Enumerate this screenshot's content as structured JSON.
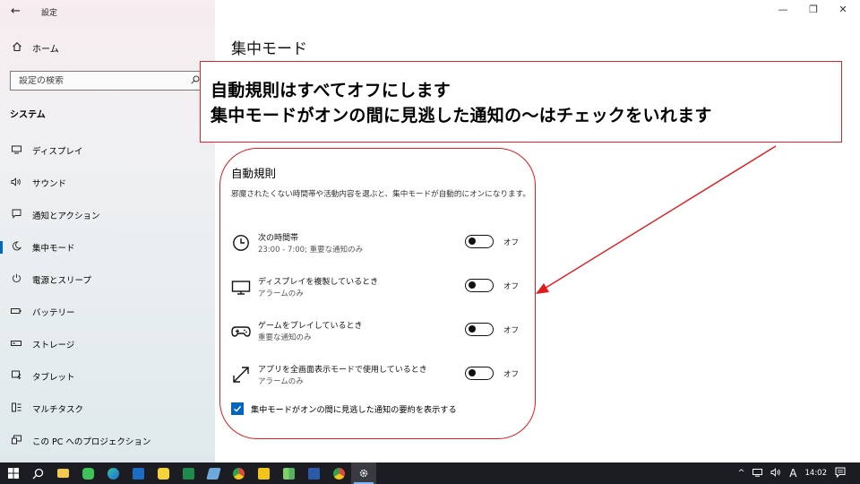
{
  "window": {
    "app_title": "設定",
    "back_glyph": "←",
    "minimize_glyph": "—",
    "restore_glyph": "❐",
    "close_glyph": "✕"
  },
  "sidebar": {
    "home_label": "ホーム",
    "search_placeholder": "設定の検索",
    "section_title": "システム",
    "items": [
      {
        "label": "ディスプレイ",
        "icon": "monitor-icon"
      },
      {
        "label": "サウンド",
        "icon": "speaker-icon"
      },
      {
        "label": "通知とアクション",
        "icon": "notification-icon"
      },
      {
        "label": "集中モード",
        "icon": "moon-icon",
        "active": true
      },
      {
        "label": "電源とスリープ",
        "icon": "power-icon"
      },
      {
        "label": "バッテリー",
        "icon": "battery-icon"
      },
      {
        "label": "ストレージ",
        "icon": "storage-icon"
      },
      {
        "label": "タブレット",
        "icon": "tablet-icon"
      },
      {
        "label": "マルチタスク",
        "icon": "multitask-icon"
      },
      {
        "label": "この PC へのプロジェクション",
        "icon": "projection-icon"
      }
    ]
  },
  "main": {
    "page_title": "集中モード",
    "callout_line1": "自動規則はすべてオフにします",
    "callout_line2": "集中モードがオンの間に見逃した通知の～はチェックをいれます",
    "auto_heading": "自動規則",
    "auto_desc": "邪魔されたくない時間帯や活動内容を選ぶと、集中モードが自動的にオンになります。",
    "rules": [
      {
        "title": "次の時間帯",
        "subtitle": "23:00 - 7:00; 重要な通知のみ",
        "toggle_label": "オフ",
        "on": false,
        "icon": "clock-icon"
      },
      {
        "title": "ディスプレイを複製しているとき",
        "subtitle": "アラームのみ",
        "toggle_label": "オフ",
        "on": false,
        "icon": "display-icon"
      },
      {
        "title": "ゲームをプレイしているとき",
        "subtitle": "重要な通知のみ",
        "toggle_label": "オフ",
        "on": false,
        "icon": "gamepad-icon"
      },
      {
        "title": "アプリを全画面表示モードで使用しているとき",
        "subtitle": "アラームのみ",
        "toggle_label": "オフ",
        "on": false,
        "icon": "fullscreen-icon"
      }
    ],
    "summary_checkbox_label": "集中モードがオンの間に見逃した通知の要約を表示する",
    "summary_checked": true
  },
  "taskbar": {
    "apps": [
      {
        "name": "search",
        "color": "#1c1d22"
      },
      {
        "name": "file-explorer",
        "color": "#f2c94c"
      },
      {
        "name": "line",
        "color": "#3ec35a"
      },
      {
        "name": "edge",
        "color": "#2a8fd8"
      },
      {
        "name": "outlook",
        "color": "#1c6cc6"
      },
      {
        "name": "sticky",
        "color": "#f5d33b"
      },
      {
        "name": "excel",
        "color": "#1f8a4c"
      },
      {
        "name": "pen",
        "color": "#6fa8dc"
      },
      {
        "name": "chrome",
        "color": "#e0493c"
      },
      {
        "name": "notes",
        "color": "#f0c419"
      },
      {
        "name": "photos",
        "color": "#57b35d"
      },
      {
        "name": "word",
        "color": "#2b5aad"
      },
      {
        "name": "chrome2",
        "color": "#e0493c"
      },
      {
        "name": "settings",
        "color": "#9aa0a6",
        "active": true
      }
    ],
    "tray_chevron": "^",
    "ime_label": "A",
    "clock": "14:02"
  }
}
